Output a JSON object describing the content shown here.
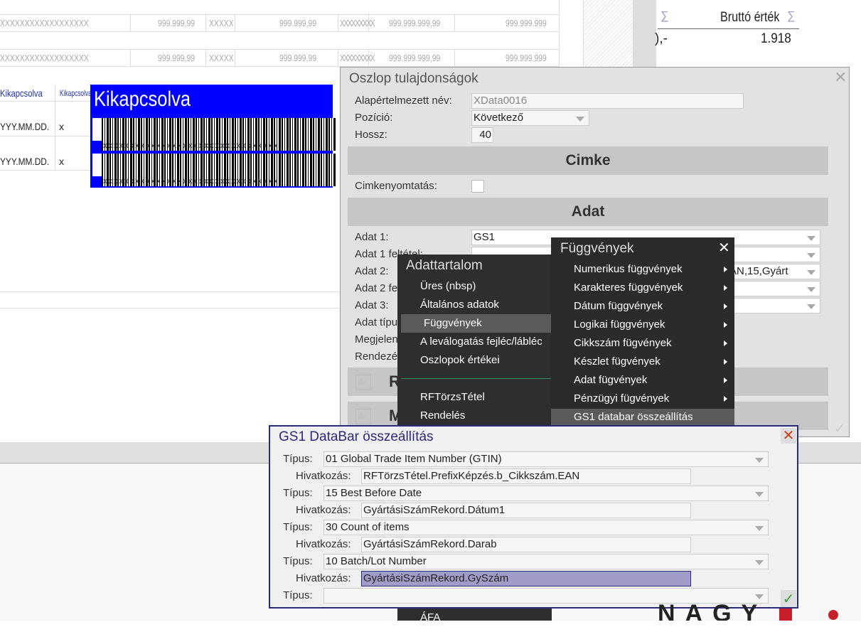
{
  "background_report": {
    "rows": [
      [
        "XXXXXXXXXXXXXXXXXX",
        "999.999,99",
        "XXXXX",
        "999.999,99",
        "XXXXXXXXX",
        "999.999.999,99",
        "999.999.999"
      ],
      [
        "XXXXXXXXXXXXXXXXXX",
        "999.999,99",
        "XXXXX",
        "999.999,99",
        "XXXXXXXXX",
        "999.999.999,99",
        "999.999.999"
      ]
    ],
    "header_cells": [
      "Kikapcsolva",
      "Kikapcsolva"
    ],
    "date_rows": [
      [
        "YYY.MM.DD.",
        "x"
      ],
      [
        "YYY.MM.DD.",
        "x"
      ]
    ],
    "barcode_title": "Kikapcsolva",
    "barcode_text": "xxxxxxxxxxxxxxxxxxxxxxxxxxxxxxxxx",
    "sigma": "∑",
    "gross_header": "Bruttó érték",
    "gross_value": "1.918",
    "partial_value": "),-"
  },
  "column_dialog": {
    "title": "Oszlop tulajdonságok",
    "default_name_label": "Alapértelmezett név:",
    "default_name_value": "XData0016",
    "position_label": "Pozíció:",
    "position_value": "Következő",
    "length_label": "Hossz:",
    "length_value": "40",
    "label_section": "Cimke",
    "label_print_label": "Cimkenyomtatás:",
    "label_print_checked": false,
    "data_section": "Adat",
    "data1_label": "Adat 1:",
    "data1_value": "GS1",
    "data1_cond_label": "Adat 1 feltétel:",
    "data2_label": "Adat 2:",
    "data2_value": "AN,15,Gyárt",
    "data2_cond_label": "Adat 2 feltétel:",
    "data3_label": "Adat 3:",
    "data_type_label": "Adat típus:",
    "display_label": "Megjelenés:",
    "sort_label": "Rendezés:",
    "collapsed_sections": [
      "R",
      "M"
    ]
  },
  "content_menu": {
    "title": "Adattartalom",
    "items": [
      "Üres (nbsp)",
      "Általános adatok",
      "Függvények",
      "A leválogatás fejléc/lábléc",
      "Oszlopok értékei"
    ],
    "items2": [
      "RFTörzsTétel",
      "Rendelés"
    ],
    "bottom_item": "ÁFA",
    "active": "Függvények"
  },
  "functions_menu": {
    "title": "Függvények",
    "items": [
      "Numerikus függvények",
      "Karakteres függvények",
      "Dátum függvények",
      "Logikai függvények",
      "Cikkszám fügvények",
      "Készlet fügvények",
      "Adat fügvények",
      "Pénzügyi fügvények"
    ],
    "gs1_item": "GS1 databar összeállítás"
  },
  "gs1_dialog": {
    "title": "GS1 DataBar összeállítás",
    "type_label": "Típus:",
    "ref_label": "Hivatkozás:",
    "rows": [
      {
        "type": "01 Global Trade Item Number (GTIN)",
        "ref": "RFTörzsTétel.PrefixKépzés.b_Cikkszám.EAN"
      },
      {
        "type": "15 Best Before Date",
        "ref": "GyártásiSzámRekord.Dátum1"
      },
      {
        "type": "30 Count of items",
        "ref": "GyártásiSzámRekord.Darab"
      },
      {
        "type": "10 Batch/Lot Number",
        "ref": "GyártásiSzámRekord.GySzám"
      }
    ],
    "last_type": ""
  },
  "logo": "NAGY",
  "colors": {
    "barcode_bg": "#0000ff",
    "dialog_border": "#2c2a7a",
    "menu_bg": "#2e2e2e",
    "selection": "#a09cc8",
    "ok": "#3aa040",
    "close": "#d04020"
  }
}
